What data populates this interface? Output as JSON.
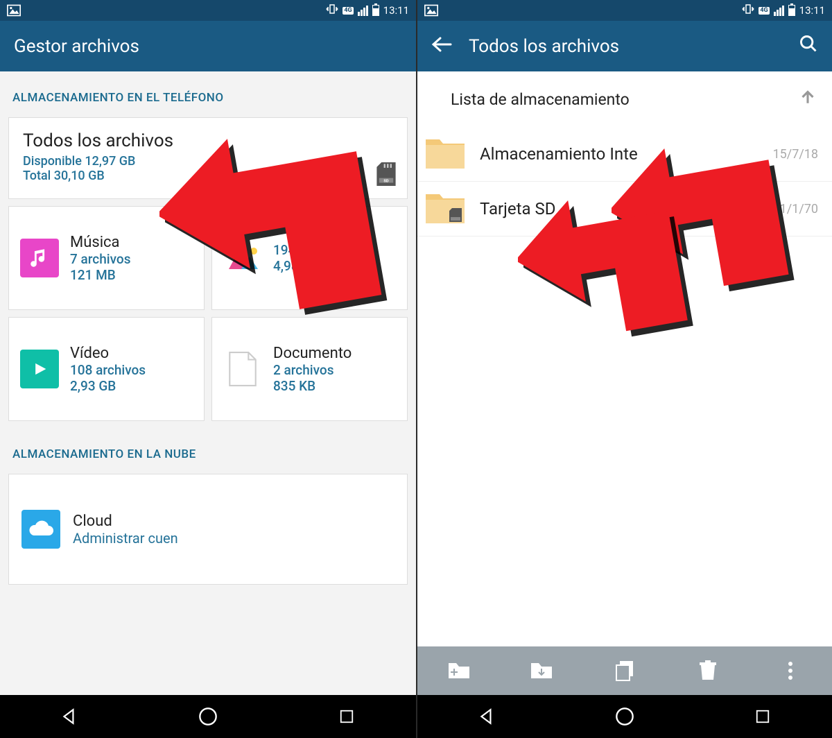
{
  "status": {
    "time": "13:11",
    "net_badge": "4G"
  },
  "left": {
    "app_title": "Gestor archivos",
    "section_phone": "ALMACENAMIENTO EN EL TELÉFONO",
    "all_files": {
      "title": "Todos los archivos",
      "available": "Disponible 12,97 GB",
      "total": "Total 30,10 GB"
    },
    "tiles": {
      "music": {
        "name": "Música",
        "count": "7 archivos",
        "size": "121 MB"
      },
      "image": {
        "name": "",
        "count": "194",
        "size": "4,98 GB"
      },
      "video": {
        "name": "Vídeo",
        "count": "108 archivos",
        "size": "2,93 GB"
      },
      "doc": {
        "name": "Documento",
        "count": "2 archivos",
        "size": "835 KB"
      }
    },
    "section_cloud": "ALMACENAMIENTO EN LA NUBE",
    "cloud": {
      "name": "Cloud",
      "sub": "Administrar cuen"
    }
  },
  "right": {
    "app_title": "Todos los archivos",
    "breadcrumb": "Lista de almacenamiento",
    "rows": [
      {
        "label": "Almacenamiento Inte",
        "date": "15/7/18"
      },
      {
        "label": "Tarjeta SD",
        "date": "1/1/70"
      }
    ]
  }
}
